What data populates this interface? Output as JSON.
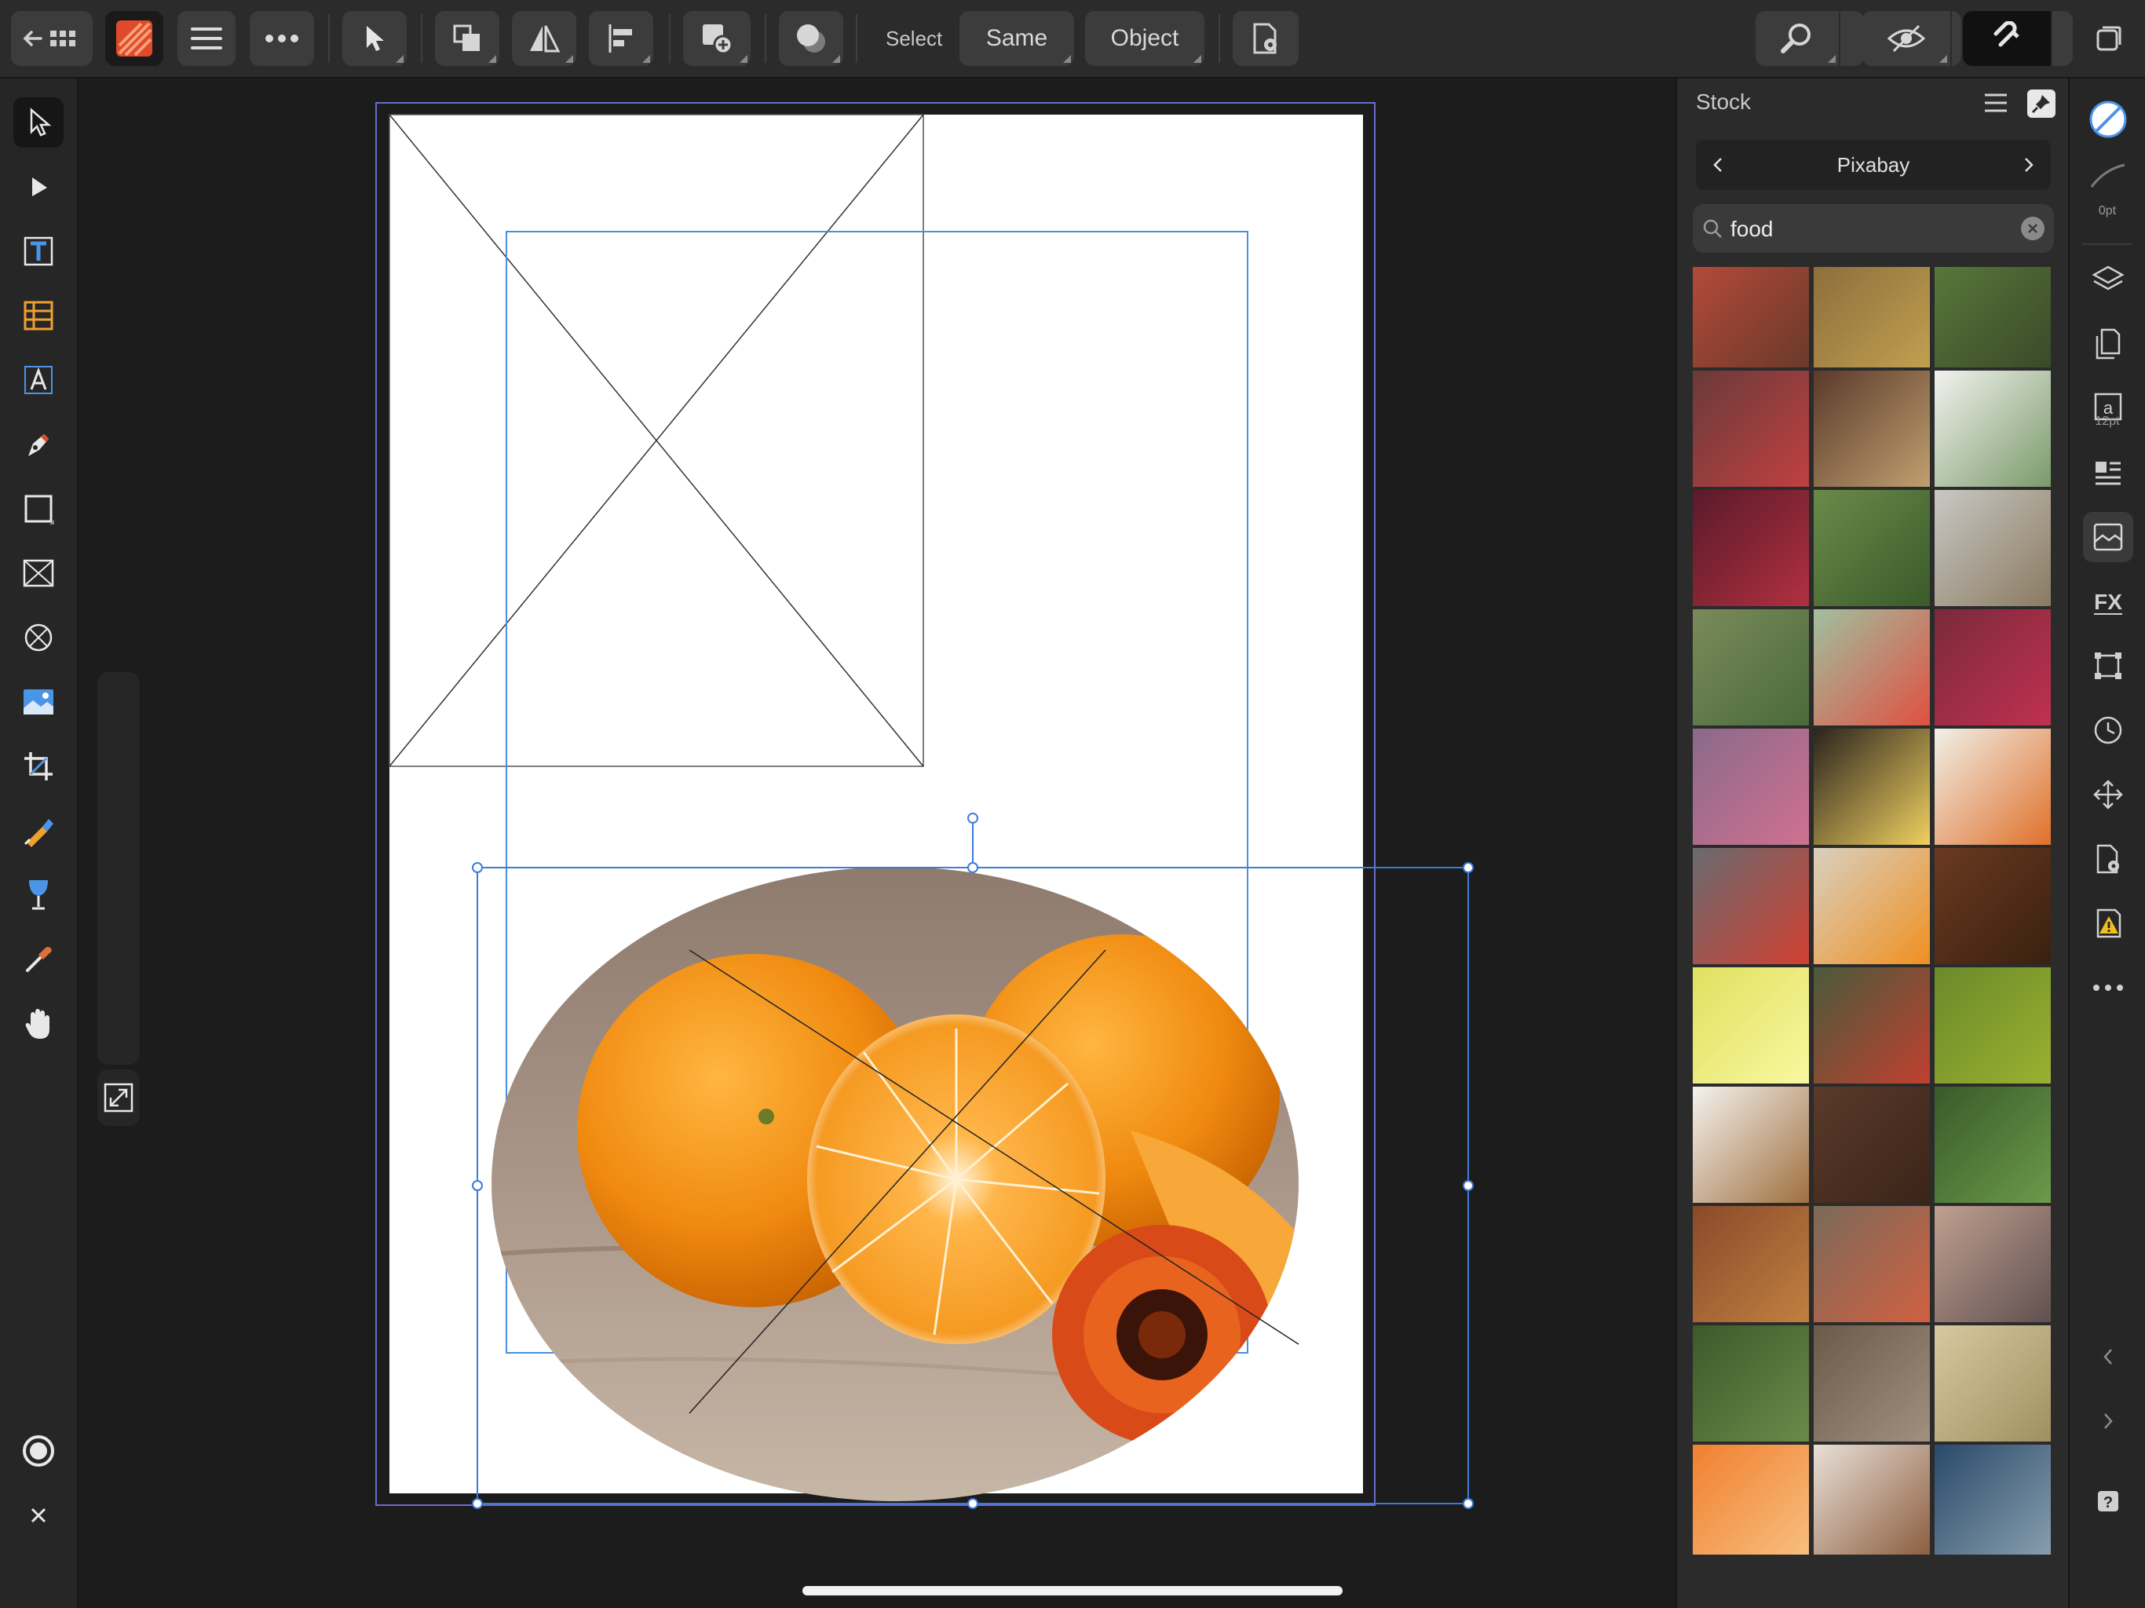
{
  "toolbar": {
    "select_label": "Select",
    "same_label": "Same",
    "object_label": "Object"
  },
  "stock": {
    "title": "Stock",
    "provider": "Pixabay",
    "search_value": "food",
    "search_placeholder": "Search"
  },
  "right_strip": {
    "stroke_width_label": "0pt",
    "text_size_label": "12pt"
  },
  "left_tools": [
    "move-tool",
    "node-tool",
    "frame-text-tool",
    "table-tool",
    "artistic-text-tool",
    "pen-tool",
    "rectangle-tool",
    "picture-frame-tool",
    "ellipse-frame-tool",
    "place-image-tool",
    "crop-tool",
    "fill-tool",
    "transparency-tool",
    "color-picker-tool",
    "view-tool"
  ],
  "right_panels": [
    "fill-stroke",
    "stroke",
    "layers",
    "pages",
    "text-styles",
    "text-frame",
    "stock",
    "effects",
    "transform",
    "history",
    "navigator",
    "preflight-warning",
    "more"
  ],
  "colors": {
    "accent": "#3d7bd8",
    "panel_bg": "#2b2b2b",
    "page_bg": "#ffffff",
    "app_icon": "#e04a2a"
  }
}
